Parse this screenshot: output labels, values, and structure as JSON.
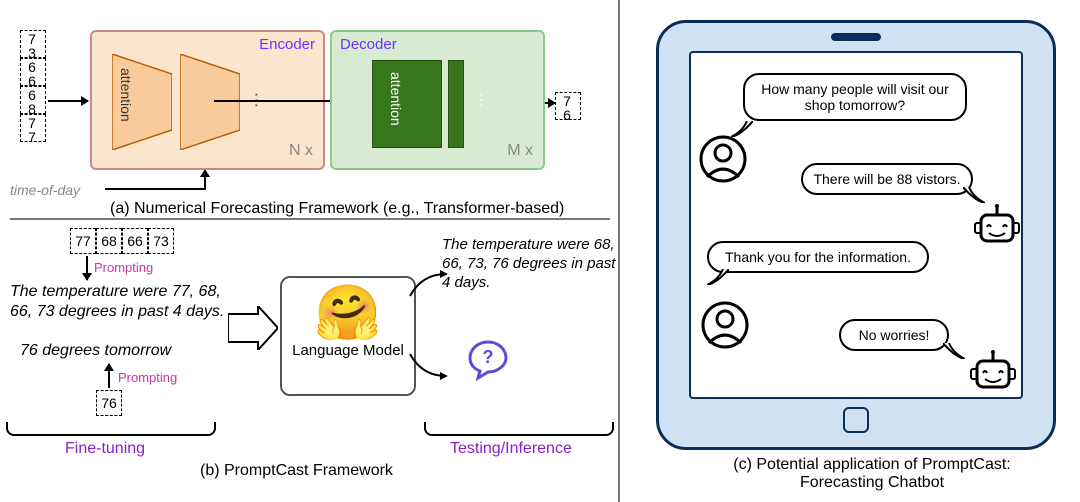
{
  "top": {
    "input_sequence": [
      "77",
      "68",
      "66",
      "73"
    ],
    "time_of_day": "time-of-day",
    "encoder_label": "Encoder",
    "decoder_label": "Decoder",
    "attention": "attention",
    "nx": "N x",
    "mx": "M x",
    "output": "76",
    "caption": "(a) Numerical Forecasting Framework (e.g., Transformer-based)"
  },
  "bottom": {
    "seq": [
      "77",
      "68",
      "66",
      "73"
    ],
    "prompting": "Prompting",
    "text1": "The temperature were 77, 68, 66, 73 degrees in past 4 days.",
    "text2": "76 degrees tomorrow",
    "out": "76",
    "fine_tuning": "Fine-tuning",
    "lm_label": "Language Model",
    "text3": "The temperature were 68, 66, 73, 76 degrees in past 4 days.",
    "testing": "Testing/Inference",
    "caption": "(b) PromptCast Framework"
  },
  "right": {
    "b1": "How many people will visit our shop tomorrow?",
    "b2": "There will be 88 vistors.",
    "b3": "Thank you for the information.",
    "b4": "No worries!",
    "caption": "(c) Potential application of PromptCast: Forecasting Chatbot"
  }
}
